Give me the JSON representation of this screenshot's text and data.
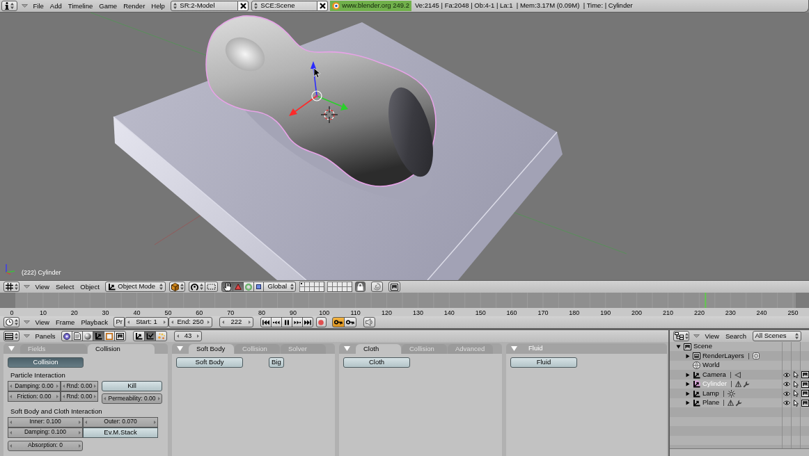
{
  "top_bar": {
    "menus": [
      "File",
      "Add",
      "Timeline",
      "Game",
      "Render",
      "Help"
    ],
    "screen": "SR:2-Model",
    "scene": "SCE:Scene",
    "version": "www.blender.org 249.2",
    "stats": "Ve:2145 | Fa:2048 | Ob:4-1 | La:1  | Mem:3.17M (0.09M)  | Time: | Cylinder"
  },
  "viewport": {
    "object_label": "(222) Cylinder"
  },
  "view3d_header": {
    "menus": [
      "View",
      "Select",
      "Object"
    ],
    "mode": "Object Mode",
    "manipulator_on": true,
    "manipulators": [
      {
        "kind": "translate",
        "selected": true
      },
      {
        "kind": "rotate",
        "selected": false
      },
      {
        "kind": "scale",
        "selected": false
      }
    ],
    "orientation": "Global",
    "layers": [
      {
        "occupied": true
      },
      {
        "occupied": false
      },
      {
        "occupied": false
      },
      {
        "occupied": false
      },
      {
        "occupied": false
      },
      {
        "occupied": false
      },
      {
        "occupied": false
      },
      {
        "occupied": false
      },
      {
        "occupied": false
      },
      {
        "occupied": false
      },
      {
        "occupied": false
      },
      {
        "occupied": false
      },
      {
        "occupied": false
      },
      {
        "occupied": false
      },
      {
        "occupied": false
      },
      {
        "occupied": false
      },
      {
        "occupied": false
      },
      {
        "occupied": false
      },
      {
        "occupied": false
      },
      {
        "occupied": false
      }
    ],
    "lock": true
  },
  "timeline": {
    "ticks": [
      "0",
      "10",
      "20",
      "30",
      "40",
      "50",
      "60",
      "70",
      "80",
      "90",
      "100",
      "110",
      "120",
      "130",
      "140",
      "150",
      "160",
      "170",
      "180",
      "190",
      "200",
      "210",
      "220",
      "230",
      "240",
      "250"
    ],
    "playhead": {
      "level": 0.888
    },
    "menus": [
      "View",
      "Frame",
      "Playback"
    ],
    "preview": "Pr",
    "start": "Start: 1",
    "end": "End: 250",
    "frame": "222",
    "playing": true,
    "auto_key": false
  },
  "buttons_window": {
    "menu": "Panels",
    "contexts": [
      {
        "kind": "logic",
        "selected": false
      },
      {
        "kind": "script",
        "selected": false
      },
      {
        "kind": "shading",
        "selected": false
      },
      {
        "kind": "object",
        "selected": true
      },
      {
        "kind": "editing",
        "selected": false
      },
      {
        "kind": "scene",
        "selected": false
      }
    ],
    "subcontexts": [
      {
        "kind": "object",
        "selected": false
      },
      {
        "kind": "physics",
        "selected": true
      },
      {
        "kind": "particles",
        "selected": false
      }
    ],
    "frame": "43"
  },
  "collision_panel": {
    "tabs": [
      {
        "label": "Fields",
        "selected": false
      },
      {
        "label": "Collision",
        "selected": true
      }
    ],
    "enable": {
      "label": "Collision",
      "on": true
    },
    "particle_title": "Particle Interaction",
    "particle_fields": [
      "Damping: 0.00",
      "Rnd: 0.00",
      "Friction: 0.00",
      "Rnd: 0.00"
    ],
    "kill": {
      "label": "Kill",
      "on": false
    },
    "permeability": "Permeability: 0.00",
    "softbody_title": "Soft Body and Cloth Interaction",
    "softbody_fields": [
      "Inner: 0.100",
      "Outer: 0.070",
      "Damping: 0.100"
    ],
    "ev_m_stack": {
      "label": "Ev.M.Stack",
      "on": false
    },
    "absorption": "Absorption: 0"
  },
  "physics_panels": [
    {
      "tabs": [
        {
          "label": "Soft Body",
          "selected": true
        },
        {
          "label": "Collision",
          "selected": false
        },
        {
          "label": "Solver",
          "selected": false
        }
      ],
      "toggles": [
        {
          "label": "Soft Body",
          "on": false
        },
        {
          "label": "Big",
          "on": false
        }
      ]
    },
    {
      "tabs": [
        {
          "label": "Cloth",
          "selected": true
        },
        {
          "label": "Collision",
          "selected": false
        },
        {
          "label": "Advanced",
          "selected": false
        }
      ],
      "toggles": [
        {
          "label": "Cloth",
          "on": false
        }
      ]
    },
    {
      "title": "Fluid",
      "toggles": [
        {
          "label": "Fluid",
          "on": false
        }
      ]
    }
  ],
  "outliner": {
    "menus": [
      "View",
      "Search"
    ],
    "filter": "All Scenes",
    "tree": [
      {
        "label": "Scene",
        "kind": "scene",
        "expanded": true,
        "selected": false,
        "children": [
          {
            "label": "RenderLayers",
            "kind": "render-layers",
            "expanded": false,
            "selected": false
          },
          {
            "label": "World",
            "kind": "world",
            "selected": false
          },
          {
            "label": "Camera",
            "kind": "camera",
            "expanded": false,
            "selected": false
          },
          {
            "label": "Cylinder",
            "kind": "mesh",
            "expanded": false,
            "selected": true
          },
          {
            "label": "Lamp",
            "kind": "lamp",
            "expanded": false,
            "selected": false
          },
          {
            "label": "Plane",
            "kind": "mesh",
            "expanded": false,
            "selected": false
          }
        ]
      }
    ]
  }
}
